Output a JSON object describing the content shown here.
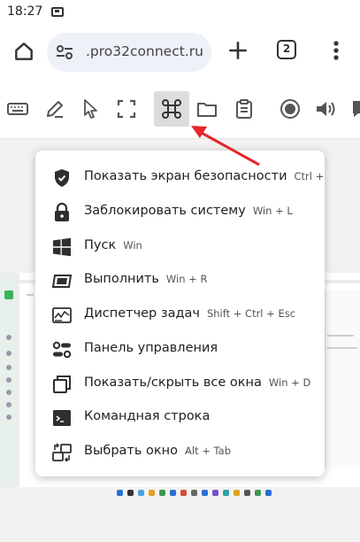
{
  "status_bar": {
    "time": "18:27"
  },
  "browser": {
    "url": ".pro32connect.ru",
    "tab_count": "2"
  },
  "toolbar": {
    "icons": [
      "keyboard-icon",
      "pen-icon",
      "pointer-icon",
      "fullscreen-icon",
      "command-icon",
      "folder-icon",
      "clipboard-icon",
      "record-icon",
      "volume-icon",
      "chat-icon"
    ],
    "active": "command-icon"
  },
  "menu": {
    "items": [
      {
        "label": "Показать экран безопасности",
        "shortcut": "Ctrl + Alt",
        "icon": "shield-icon"
      },
      {
        "label": "Заблокировать систему",
        "shortcut": "Win + L",
        "icon": "lock-icon"
      },
      {
        "label": "Пуск",
        "shortcut": "Win",
        "icon": "windows-logo-icon"
      },
      {
        "label": "Выполнить",
        "shortcut": "Win + R",
        "icon": "run-icon"
      },
      {
        "label": "Диспетчер задач",
        "shortcut": "Shift + Ctrl + Esc",
        "icon": "task-manager-icon"
      },
      {
        "label": "Панель управления",
        "shortcut": "",
        "icon": "control-panel-icon"
      },
      {
        "label": "Показать/скрыть все окна",
        "shortcut": "Win + D",
        "icon": "windows-stack-icon"
      },
      {
        "label": "Командная строка",
        "shortcut": "",
        "icon": "terminal-icon"
      },
      {
        "label": "Выбрать окно",
        "shortcut": "Alt + Tab",
        "icon": "switch-window-icon"
      }
    ]
  },
  "colors": {
    "accent_arrow": "#e5262a",
    "active_tool_bg": "#dcdcdc"
  }
}
